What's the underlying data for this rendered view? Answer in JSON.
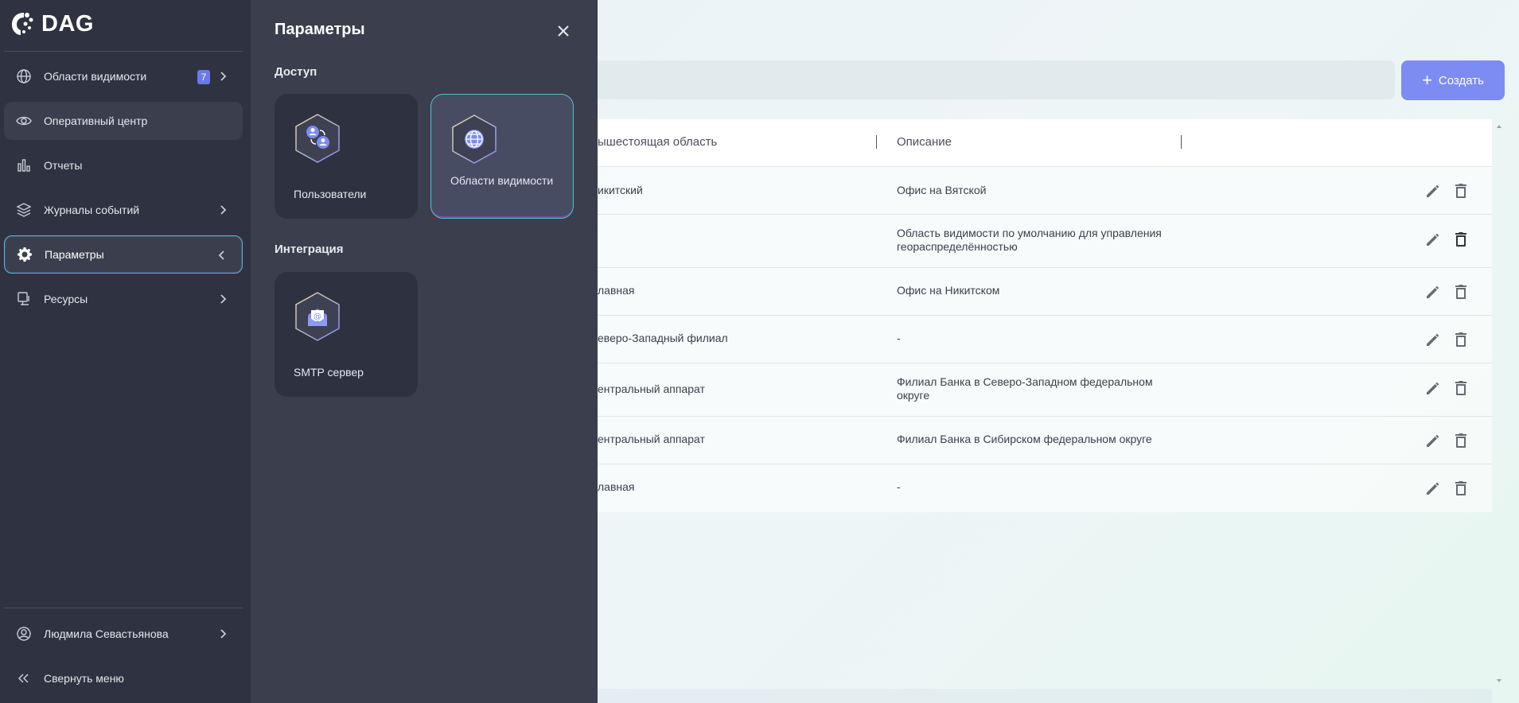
{
  "app": {
    "logo_text": "DAG"
  },
  "sidebar": {
    "items": [
      {
        "label": "Области видимости",
        "badge": "7"
      },
      {
        "label": "Оперативный центр"
      },
      {
        "label": "Отчеты"
      },
      {
        "label": "Журналы событий"
      },
      {
        "label": "Параметры"
      },
      {
        "label": "Ресурсы"
      }
    ],
    "user_name": "Людмила Севастьянова",
    "collapse_label": "Свернуть меню"
  },
  "panel": {
    "title": "Параметры",
    "sections": [
      {
        "title": "Доступ",
        "cards": [
          {
            "label": "Пользователи",
            "icon": "users-icon"
          },
          {
            "label": "Области видимости",
            "icon": "globe-icon"
          }
        ]
      },
      {
        "title": "Интеграция",
        "cards": [
          {
            "label": "SMTP сервер",
            "icon": "mail-icon"
          }
        ]
      }
    ]
  },
  "toolbar": {
    "create_label": "Создать"
  },
  "table": {
    "headers": {
      "parent": "ышестоящая область",
      "description": "Описание"
    },
    "rows": [
      {
        "parent": "икитский",
        "description": "Офис на Вятской"
      },
      {
        "parent": "",
        "description": "Область видимости по умолчанию для управления георaспределённостью"
      },
      {
        "parent": "лавная",
        "description": "Офис на Никитском"
      },
      {
        "parent": "еверо-Западный филиал",
        "description": "-"
      },
      {
        "parent": "ентральный аппарат",
        "description": "Филиал Банка в Северо-Западном федеральном округе"
      },
      {
        "parent": "ентральный аппарат",
        "description": "Филиал Банка в Сибирском федеральном округе"
      },
      {
        "parent": "лавная",
        "description": "-"
      }
    ]
  },
  "colors": {
    "sidebar_bg": "#2f3240",
    "panel_bg": "#3b3e4c",
    "accent": "#7c8cf2",
    "active_border": "#47c0d1"
  }
}
